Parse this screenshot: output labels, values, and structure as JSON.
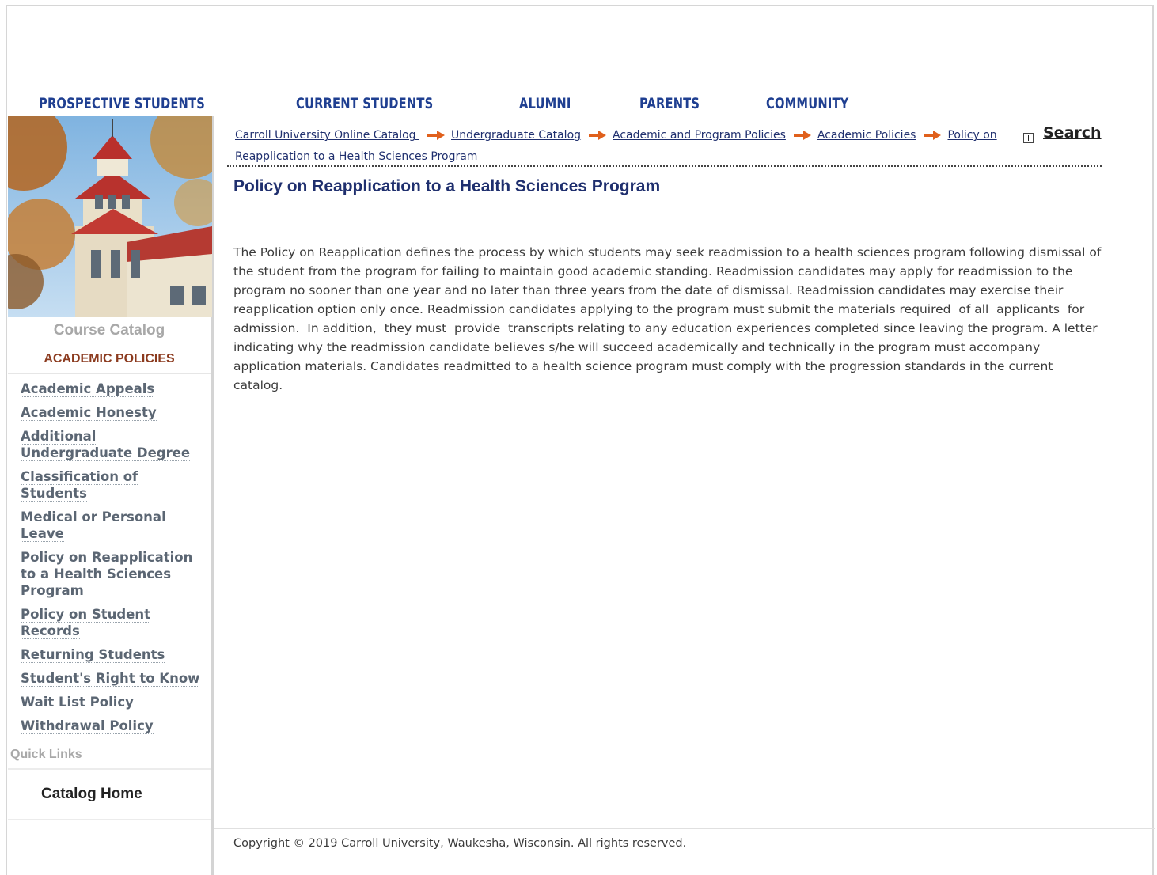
{
  "topnav": [
    "PROSPECTIVE STUDENTS",
    "CURRENT STUDENTS",
    "ALUMNI",
    "PARENTS",
    "COMMUNITY"
  ],
  "sidebar": {
    "title": "Course Catalog",
    "section_heading": "ACADEMIC POLICIES",
    "links": [
      "Academic Appeals",
      "Academic Honesty",
      "Additional Undergraduate Degree",
      "Classification of Students",
      "Medical or Personal Leave",
      "Policy on Reapplication to a Health Sciences Program",
      "Policy on Student Records",
      "Returning Students",
      "Student's Right to Know",
      "Wait List Policy",
      "Withdrawal Policy"
    ],
    "current_index": 5,
    "quick_links_title": "Quick Links",
    "quick_links": [
      "Catalog Home"
    ]
  },
  "breadcrumb": [
    "Carroll University Online Catalog ",
    "Undergraduate Catalog",
    "Academic and Program Policies",
    "Academic Policies",
    "Policy on Reapplication to a Health Sciences Program"
  ],
  "search_label": "Search",
  "page_title": "Policy on Reapplication to a Health Sciences Program",
  "body": "The Policy on Reapplication defines the process by which students may seek readmission to a health sciences program following dismissal of the student from the program for failing to maintain good academic standing. Readmission candidates may apply for readmission to the program no sooner than one year and no later than three years from the date of dismissal. Readmission candidates may exercise their reapplication option only once. Readmission candidates applying to the program must submit the materials required  of all  applicants  for admission.  In addition,  they must  provide  transcripts relating to any education experiences completed since leaving the program. A letter indicating why the readmission candidate believes s/he will succeed academically and technically in the program must accompany application materials. Candidates readmitted to a health science program must comply with the progression standards in the current catalog.",
  "footer": "Copyright © 2019 Carroll University, Waukesha, Wisconsin. All rights reserved.",
  "colors": {
    "nav": "#1f3f91",
    "heading": "#1f2f6e",
    "section": "#8b3a1e",
    "arrow": "#e0601c"
  }
}
